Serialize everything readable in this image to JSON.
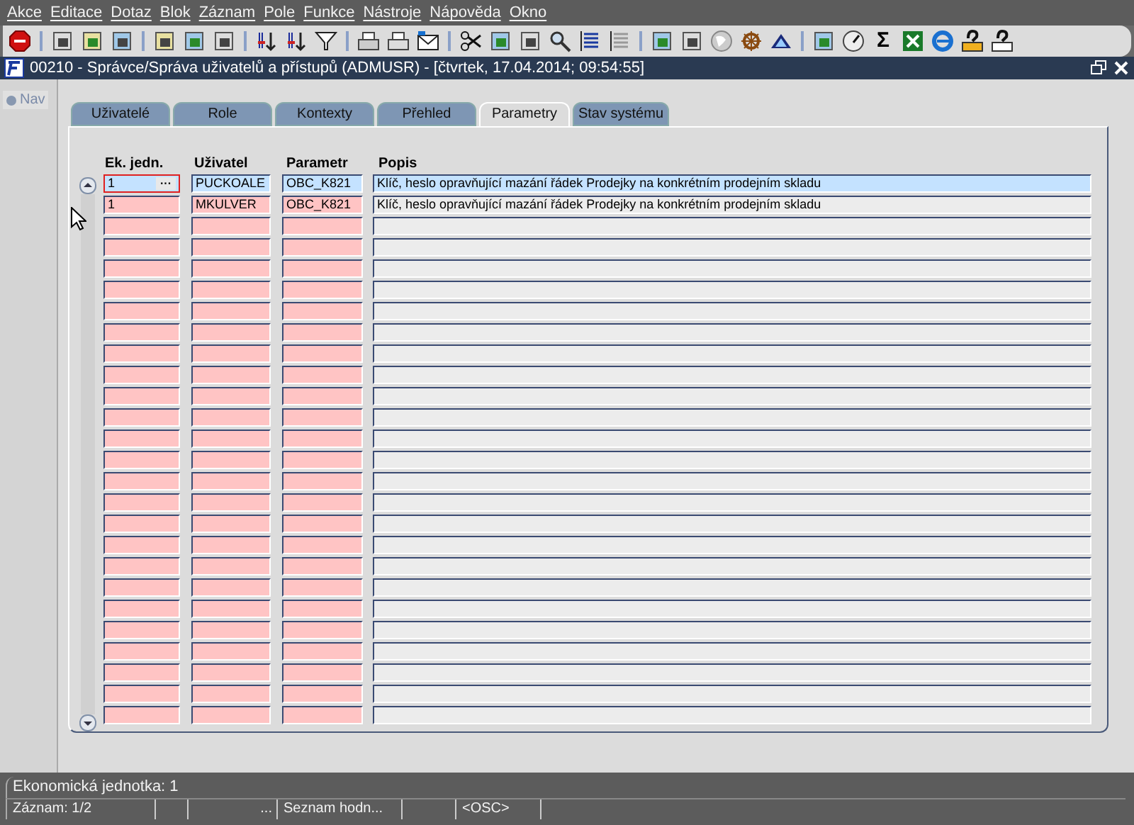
{
  "menu": [
    {
      "label": "Akce"
    },
    {
      "label": "Editace"
    },
    {
      "label": "Dotaz"
    },
    {
      "label": "Blok"
    },
    {
      "label": "Záznam"
    },
    {
      "label": "Pole"
    },
    {
      "label": "Funkce"
    },
    {
      "label": "Nástroje"
    },
    {
      "label": "Nápověda"
    },
    {
      "label": "Okno"
    }
  ],
  "toolbar": {
    "sum_glyph": "Σ"
  },
  "window": {
    "title": "00210 - Správce/Správa uživatelů a přístupů (ADMUSR) - [čtvrtek, 17.04.2014; 09:54:55]"
  },
  "nav": {
    "label": "Nav"
  },
  "tabs": [
    {
      "label": "Uživatelé",
      "selected": false
    },
    {
      "label": "Role",
      "selected": false
    },
    {
      "label": "Kontexty",
      "selected": false
    },
    {
      "label": "Přehled",
      "selected": false
    },
    {
      "label": "Parametry",
      "selected": true
    },
    {
      "label": "Stav systému",
      "selected": false
    }
  ],
  "table": {
    "columns": [
      "Ek. jedn.",
      "Uživatel",
      "Parametr",
      "Popis"
    ],
    "rows": [
      {
        "selected": true,
        "ek": "1",
        "lov_button": "···",
        "uzivatel": "PUCKOALE",
        "parametr": "OBC_K821",
        "popis": "Klíč, heslo opravňující mazání řádek Prodejky na konkrétním prodejním skladu"
      },
      {
        "selected": false,
        "ek": "1",
        "uzivatel": "MKULVER",
        "parametr": "OBC_K821",
        "popis": "Klíč, heslo opravňující mazání řádek Prodejky na konkrétním prodejním skladu"
      },
      {
        "selected": false
      },
      {
        "selected": false
      },
      {
        "selected": false
      },
      {
        "selected": false
      },
      {
        "selected": false
      },
      {
        "selected": false
      },
      {
        "selected": false
      },
      {
        "selected": false
      },
      {
        "selected": false
      },
      {
        "selected": false
      },
      {
        "selected": false
      },
      {
        "selected": false
      },
      {
        "selected": false
      },
      {
        "selected": false
      },
      {
        "selected": false
      },
      {
        "selected": false
      },
      {
        "selected": false
      },
      {
        "selected": false
      },
      {
        "selected": false
      },
      {
        "selected": false
      },
      {
        "selected": false
      },
      {
        "selected": false
      },
      {
        "selected": false
      },
      {
        "selected": false
      }
    ]
  },
  "status_bar": {
    "message": "Ekonomická jednotka: 1",
    "cells": [
      "Záznam: 1/2",
      "",
      "...",
      "Seznam hodn...",
      "",
      "<OSC>"
    ]
  }
}
